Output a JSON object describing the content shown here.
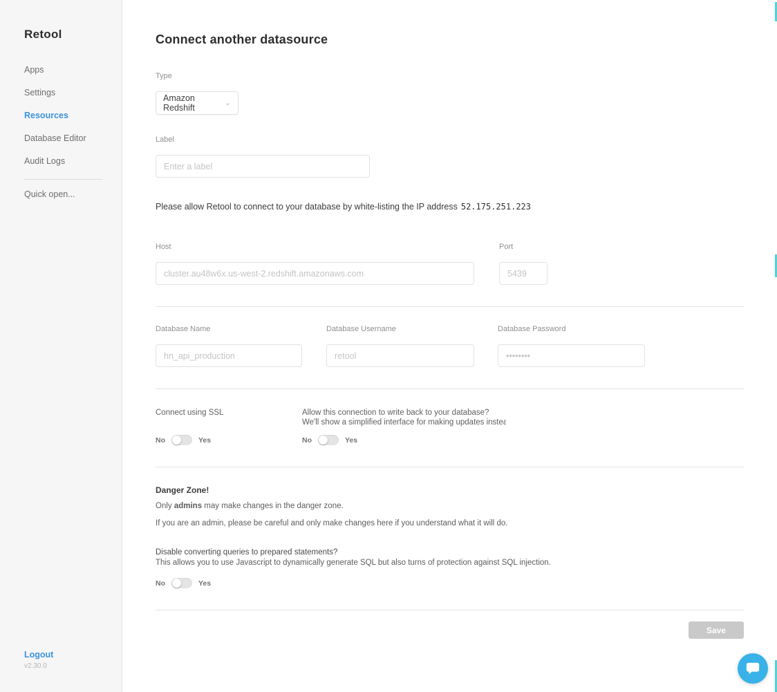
{
  "sidebar": {
    "logo": "Retool",
    "items": [
      {
        "label": "Apps"
      },
      {
        "label": "Settings"
      },
      {
        "label": "Resources"
      },
      {
        "label": "Database Editor"
      },
      {
        "label": "Audit Logs"
      },
      {
        "label": "Quick open..."
      }
    ],
    "logout_label": "Logout",
    "version": "v2.30.0"
  },
  "page": {
    "title": "Connect another datasource"
  },
  "form": {
    "type": {
      "label": "Type",
      "value": "Amazon Redshift"
    },
    "label": {
      "label": "Label",
      "placeholder": "Enter a label"
    },
    "ip_notice_text": "Please allow Retool to connect to your database by white-listing the IP address",
    "ip_address": "52.175.251.223",
    "host": {
      "label": "Host",
      "placeholder": "cluster.au48w6x.us-west-2.redshift.amazonaws.com"
    },
    "port": {
      "label": "Port",
      "placeholder": "5439"
    },
    "database_name": {
      "label": "Database Name",
      "placeholder": "hn_api_production"
    },
    "database_username": {
      "label": "Database Username",
      "placeholder": "retool"
    },
    "database_password": {
      "label": "Database Password",
      "placeholder": "••••••••"
    },
    "ssl": {
      "label": "Connect using SSL",
      "no_label": "No",
      "yes_label": "Yes"
    },
    "write_back": {
      "line1": "Allow this connection to write back to your database?",
      "line2": "We'll show a simplified interface for making updates instead of a SQ",
      "no_label": "No",
      "yes_label": "Yes"
    },
    "danger_zone": {
      "title": "Danger Zone!",
      "admins_prefix": "Only ",
      "admins_bold": "admins",
      "admins_suffix": " may make changes in the danger zone.",
      "caution": "If you are an admin, please be careful and only make changes here if you understand what it will do.",
      "prepared_question": "Disable converting queries to prepared statements?",
      "prepared_description": "This allows you to use Javascript to dynamically generate SQL but also turns of protection against SQL injection.",
      "no_label": "No",
      "yes_label": "Yes"
    },
    "save_label": "Save"
  },
  "colors": {
    "accent_blue": "#3c92dc",
    "intercom_blue": "#38b2e8",
    "edge_tick_teal": "#4ed4dc",
    "save_button_gray": "#c9c9c9"
  }
}
